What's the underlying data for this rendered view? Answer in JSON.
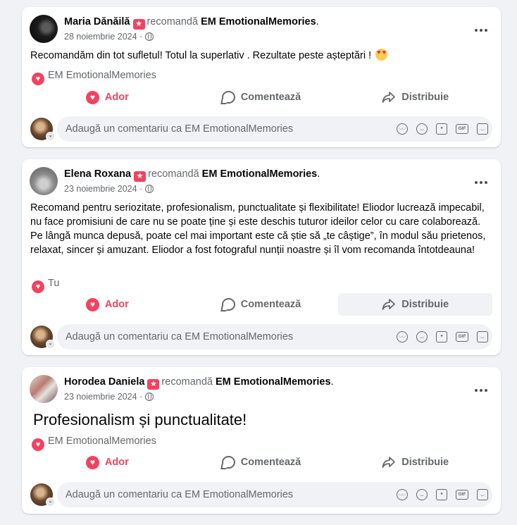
{
  "common": {
    "verb": "recomandă",
    "page_name": "EM EmotionalMemories",
    "separator": "·",
    "more_icon": "more-options-icon",
    "actions": {
      "love": "Ador",
      "comment": "Comentează",
      "share": "Distribuie"
    },
    "comment_placeholder": "Adaugă un comentariu ca EM EmotionalMemories",
    "comment_tools": [
      "avatar-sticker-icon",
      "emoji-icon",
      "camera-icon",
      "gif-icon",
      "sticker-icon"
    ],
    "accent_color": "#f3425f"
  },
  "posts": [
    {
      "author": "Maria Dănăilă",
      "date": "28 noiembrie 2024",
      "text": "Recomandăm  din tot sufletul! Totul la superlativ . Rezultate peste așteptări !",
      "reaction_label": "EM EmotionalMemories"
    },
    {
      "author": "Elena Roxana",
      "date": "23 noiembrie 2024",
      "text": "Recomand pentru seriozitate, profesionalism, punctualitate și flexibilitate! Eliodor lucrează impecabil, nu face promisiuni de care nu se poate ține și este deschis tuturor ideilor celor cu care colaborează. Pe lângă munca depusă, poate cel mai important este că știe să „te câștige”, în modul său prietenos, relaxat, sincer și amuzant. Eliodor a fost fotograful nunții noastre și îl vom recomanda întotdeauna!",
      "reaction_label": "Tu"
    },
    {
      "author": "Horodea Daniela",
      "date": "23 noiembrie 2024",
      "text": "Profesionalism și punctualitate!",
      "reaction_label": "EM EmotionalMemories"
    }
  ]
}
